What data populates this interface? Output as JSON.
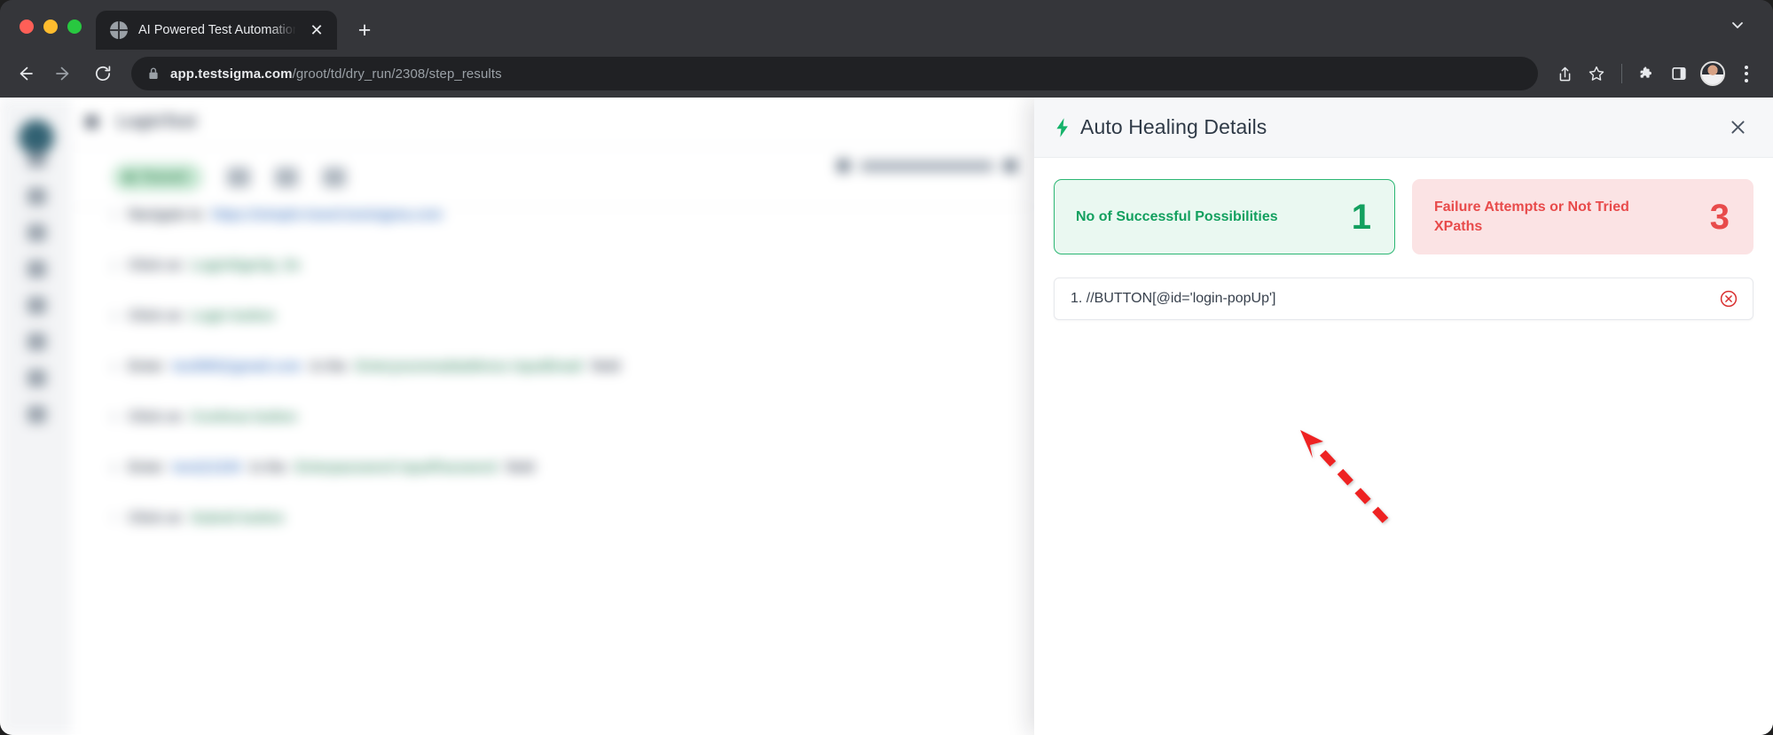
{
  "browser": {
    "tab": {
      "title": "AI Powered Test Automation Pla",
      "favicon_name": "globe-icon",
      "close_label": "✕"
    },
    "new_tab_label": "+",
    "tabstrip_chevron_name": "chevron-down-icon",
    "toolbar": {
      "back_label": "←",
      "forward_label": "→",
      "reload_label": "⟳",
      "url_secure_prefix": "app.testsigma.com",
      "url_path": "/groot/td/dry_run/2308/step_results",
      "share_name": "share-icon",
      "bookmark_name": "star-icon",
      "extensions_name": "puzzle-piece-icon",
      "sidepanel_name": "side-panel-icon",
      "profile_name": "avatar",
      "menu_name": "three-dot-menu-icon"
    }
  },
  "app": {
    "page_title": "LoginTest",
    "status_badge": "Passed",
    "sidebar_item_count": 8,
    "steps": [
      {
        "index": "1",
        "parts": [
          {
            "text": "Navigate to",
            "kind": "plain"
          },
          {
            "text": "https://simple-travel.testsigma.com",
            "kind": "link"
          }
        ]
      },
      {
        "index": "2",
        "parts": [
          {
            "text": "Click on",
            "kind": "plain"
          },
          {
            "text": "LoginSignUp_lin",
            "kind": "elem"
          }
        ]
      },
      {
        "index": "3",
        "parts": [
          {
            "text": "Click on",
            "kind": "plain"
          },
          {
            "text": "Login button",
            "kind": "elem"
          }
        ]
      },
      {
        "index": "4",
        "parts": [
          {
            "text": "Enter",
            "kind": "plain"
          },
          {
            "text": "test500@gmail.com",
            "kind": "link"
          },
          {
            "text": "in the",
            "kind": "plain"
          },
          {
            "text": "Enteryouremailaddress inputEmail",
            "kind": "elem"
          },
          {
            "text": "field",
            "kind": "plain"
          }
        ]
      },
      {
        "index": "5",
        "parts": [
          {
            "text": "Click on",
            "kind": "plain"
          },
          {
            "text": "Continue button",
            "kind": "elem"
          }
        ]
      },
      {
        "index": "6",
        "parts": [
          {
            "text": "Enter",
            "kind": "plain"
          },
          {
            "text": "test@1234",
            "kind": "link"
          },
          {
            "text": "in the",
            "kind": "plain"
          },
          {
            "text": "Enterpassword inputPassword",
            "kind": "elem"
          },
          {
            "text": "field",
            "kind": "plain"
          }
        ]
      },
      {
        "index": "7",
        "parts": [
          {
            "text": "Click on",
            "kind": "plain"
          },
          {
            "text": "Submit button",
            "kind": "elem"
          }
        ]
      }
    ]
  },
  "panel": {
    "icon_name": "lightning-bolt-icon",
    "title": "Auto Healing Details",
    "close_name": "close-icon",
    "cards": [
      {
        "id": "success",
        "label": "No of Successful Possibilities",
        "value": "1",
        "color": "#13a05f"
      },
      {
        "id": "failure",
        "label": "Failure Attempts or Not Tried XPaths",
        "value": "3",
        "color": "#e84b4b"
      }
    ],
    "xpaths": [
      {
        "text": "1. //BUTTON[@id='login-popUp']",
        "delete_name": "remove-xpath-icon"
      }
    ]
  },
  "annotation": {
    "type": "dashed-arrow",
    "color": "#ee2020",
    "points_to": "xpath-row-1"
  }
}
